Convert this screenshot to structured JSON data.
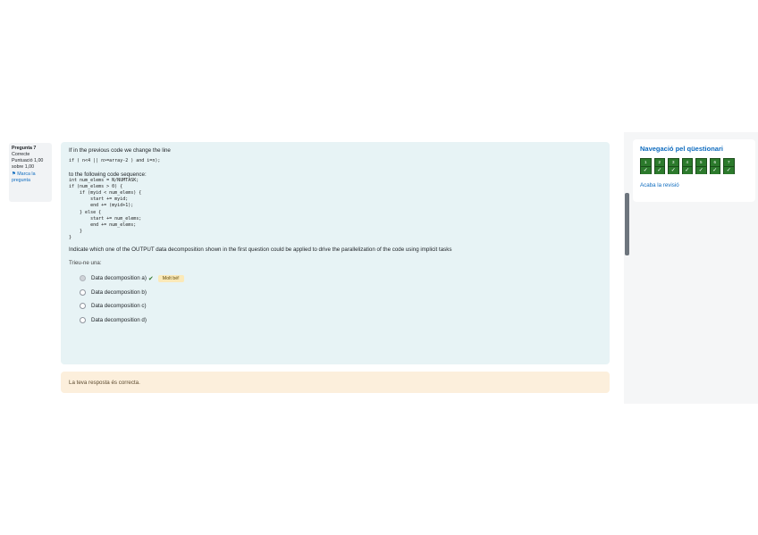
{
  "question_info": {
    "number_label": "Pregunta 7",
    "state": "Correcte",
    "mark": "Puntuació 1,00",
    "mark_out_of": "sobre 1,00",
    "flag_label": "Marca la pregunta"
  },
  "question": {
    "intro": "If in the previous code we change the line",
    "code_line": "if ( n<4 || n>=array-2 ) and i=n);",
    "following": "to the following code sequence:",
    "code_block": [
      "int num_elems = N/NUMTASK;",
      "if (num_elems > 0) {",
      "    if (myid < num_elems) {",
      "        start += myid;",
      "        end += (myid+1);",
      "    } else {",
      "        start += num_elems;",
      "        end += num_elems;",
      "    }",
      "}"
    ],
    "prompt": "Indicate which one of the OUTPUT data decomposition shown in the first question could be applied to drive the parallelization of the code using implicit tasks",
    "choose_label": "Trieu-ne una:",
    "options": [
      {
        "label": "Data decomposition a)",
        "checked": true,
        "correct": true
      },
      {
        "label": "Data decomposition b)",
        "checked": false
      },
      {
        "label": "Data decomposition c)",
        "checked": false
      },
      {
        "label": "Data decomposition d)",
        "checked": false
      }
    ],
    "correct_badge": "Molt bé!"
  },
  "feedback": {
    "text": "La teva resposta és correcta."
  },
  "navigation": {
    "title": "Navegació pel qüestionari",
    "buttons": [
      {
        "number": "1",
        "status": "✓"
      },
      {
        "number": "2",
        "status": "✓"
      },
      {
        "number": "3",
        "status": "✓"
      },
      {
        "number": "4",
        "status": "✓"
      },
      {
        "number": "5",
        "status": "✓"
      },
      {
        "number": "6",
        "status": "✓"
      },
      {
        "number": "7",
        "status": "✓"
      }
    ],
    "finish_label": "Acaba la revisió"
  },
  "colors": {
    "question_bg": "#e7f3f5",
    "feedback_bg": "#fcefdc",
    "nav_correct": "#2c7a2c",
    "link": "#0f6cbf",
    "badge_bg": "#fbe9b8"
  }
}
